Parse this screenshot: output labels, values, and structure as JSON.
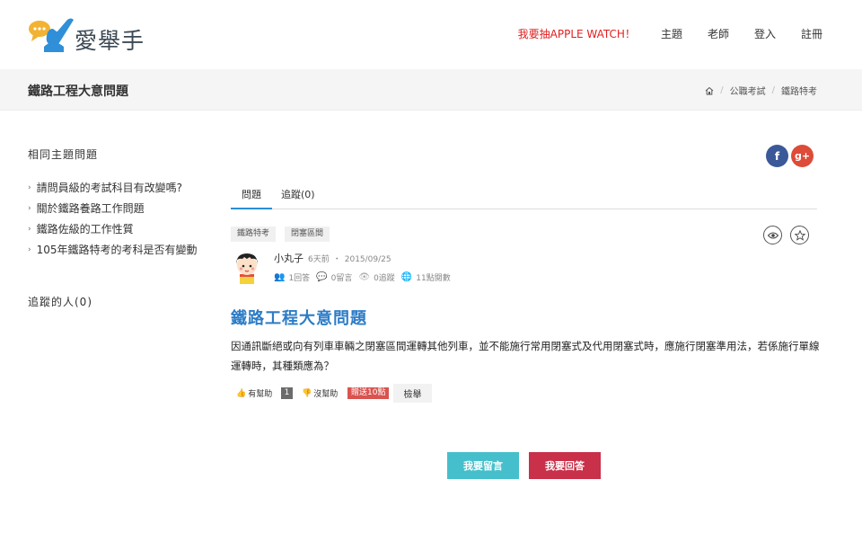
{
  "logo": {
    "text": "愛舉手"
  },
  "nav": {
    "promo": "我要抽APPLE WATCH！",
    "topics": "主題",
    "teachers": "老師",
    "login": "登入",
    "register": "註冊"
  },
  "page_title": "鐵路工程大意問題",
  "breadcrumb": {
    "level1": "公職考試",
    "level2": "鐵路特考",
    "separator": "/"
  },
  "sidebar": {
    "related_heading": "相同主題問題",
    "related": [
      "請問員級的考試科目有改變嗎?",
      "關於鐵路養路工作問題",
      "鐵路佐級的工作性質",
      "105年鐵路特考的考科是否有變動"
    ],
    "followers_heading": "追蹤的人(0)"
  },
  "social": {
    "facebook": "f",
    "googleplus": "g+"
  },
  "tabs": {
    "question": "問題",
    "follow": "追蹤(0)"
  },
  "tags": [
    "鐵路特考",
    "閉塞區間"
  ],
  "author": {
    "name": "小丸子",
    "time_ago": "6天前",
    "dot": "・",
    "date": "2015/09/25"
  },
  "stats": {
    "answers": "1回答",
    "comments": "0留言",
    "follows": "0追蹤",
    "views": "11點閱數"
  },
  "question": {
    "title": "鐵路工程大意問題",
    "body": "因通訊斷絕或向有列車車輛之閉塞區間運轉其他列車，並不能施行常用閉塞式及代用閉塞式時，應施行閉塞準用法，若係施行單線運轉時，其種類應為？"
  },
  "vote": {
    "helpful": "有幫助",
    "count": "1",
    "unhelpful": "沒幫助",
    "bounty": "贈送10點",
    "report": "檢舉"
  },
  "buttons": {
    "comment": "我要留言",
    "answer": "我要回答"
  },
  "colors": {
    "accent_blue": "#2c7cc7",
    "promo_red": "#e02020",
    "comment_btn": "#46bfcc",
    "answer_btn": "#c9304a",
    "bounty": "#d9534f"
  }
}
